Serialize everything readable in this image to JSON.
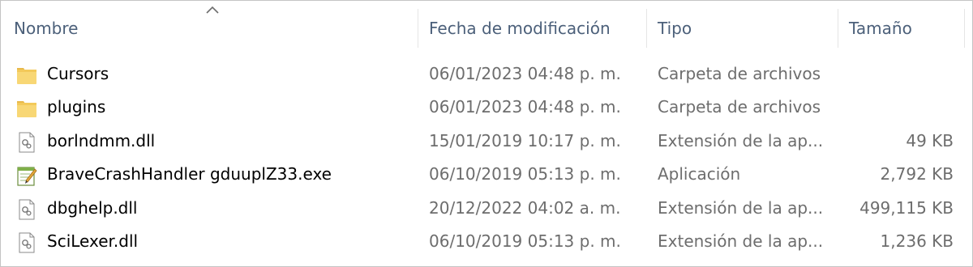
{
  "columns": {
    "name": "Nombre",
    "date": "Fecha de modificación",
    "type": "Tipo",
    "size": "Tamaño"
  },
  "sort": {
    "column": "name",
    "icon": "chevron-up-icon"
  },
  "files": [
    {
      "name": "Cursors",
      "date": "06/01/2023 04:48 p. m.",
      "type": "Carpeta de archivos",
      "size": "",
      "icon": "folder-icon"
    },
    {
      "name": "plugins",
      "date": "06/01/2023 04:48 p. m.",
      "type": "Carpeta de archivos",
      "size": "",
      "icon": "folder-icon"
    },
    {
      "name": "borlndmm.dll",
      "date": "15/01/2019 10:17 p. m.",
      "type": "Extensión de la ap...",
      "size": "49 KB",
      "icon": "dll-file-icon"
    },
    {
      "name": "BraveCrashHandler gduuplZ33.exe",
      "date": "06/10/2019 05:13 p. m.",
      "type": "Aplicación",
      "size": "2,792 KB",
      "icon": "exe-file-icon"
    },
    {
      "name": "dbghelp.dll",
      "date": "20/12/2022 04:02 a. m.",
      "type": "Extensión de la ap...",
      "size": "499,115 KB",
      "icon": "dll-file-icon"
    },
    {
      "name": "SciLexer.dll",
      "date": "06/10/2019 05:13 p. m.",
      "type": "Extensión de la ap...",
      "size": "1,236 KB",
      "icon": "dll-file-icon"
    }
  ],
  "colors": {
    "header_text": "#4c607a",
    "folder": "#f8d775",
    "secondary_text": "#6d6d6d"
  }
}
